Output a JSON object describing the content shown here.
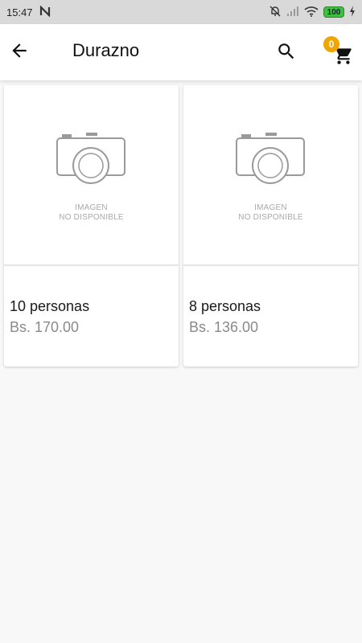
{
  "status_bar": {
    "time": "15:47",
    "battery": "100",
    "icons": [
      "notification-n-icon",
      "mute-icon",
      "signal-icon",
      "wifi-icon",
      "battery-icon",
      "charging-icon"
    ]
  },
  "app_bar": {
    "title": "Durazno",
    "cart_count": "0",
    "icons": [
      "back-arrow-icon",
      "search-icon",
      "cart-icon"
    ]
  },
  "products": [
    {
      "image_text_line1": "IMAGEN",
      "image_text_line2": "NO DISPONIBLE",
      "name": "10 personas",
      "price": "Bs. 170.00"
    },
    {
      "image_text_line1": "IMAGEN",
      "image_text_line2": "NO DISPONIBLE",
      "name": "8 personas",
      "price": "Bs. 136.00"
    }
  ],
  "colors": {
    "badge": "#f0a500",
    "battery": "#3fbf3f",
    "background": "#f8f8f8"
  }
}
